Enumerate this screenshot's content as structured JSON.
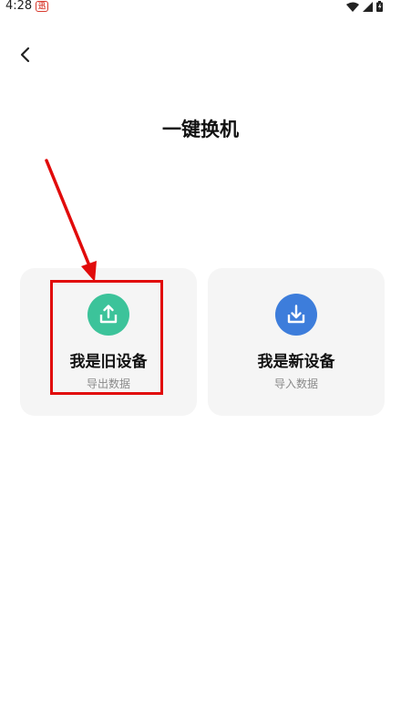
{
  "status_bar": {
    "time": "4:28",
    "app_icon_glyph": "迅",
    "icons": [
      "wifi-icon",
      "signal-icon",
      "battery-icon"
    ]
  },
  "nav": {
    "back_icon": "chevron-left-icon"
  },
  "page": {
    "title": "一键换机"
  },
  "options": [
    {
      "title": "我是旧设备",
      "subtitle": "导出数据",
      "icon": "upload-icon",
      "color": "#3cc39a"
    },
    {
      "title": "我是新设备",
      "subtitle": "导入数据",
      "icon": "download-icon",
      "color": "#3d7ddb"
    }
  ],
  "annotation": {
    "color": "#e10b0b"
  }
}
